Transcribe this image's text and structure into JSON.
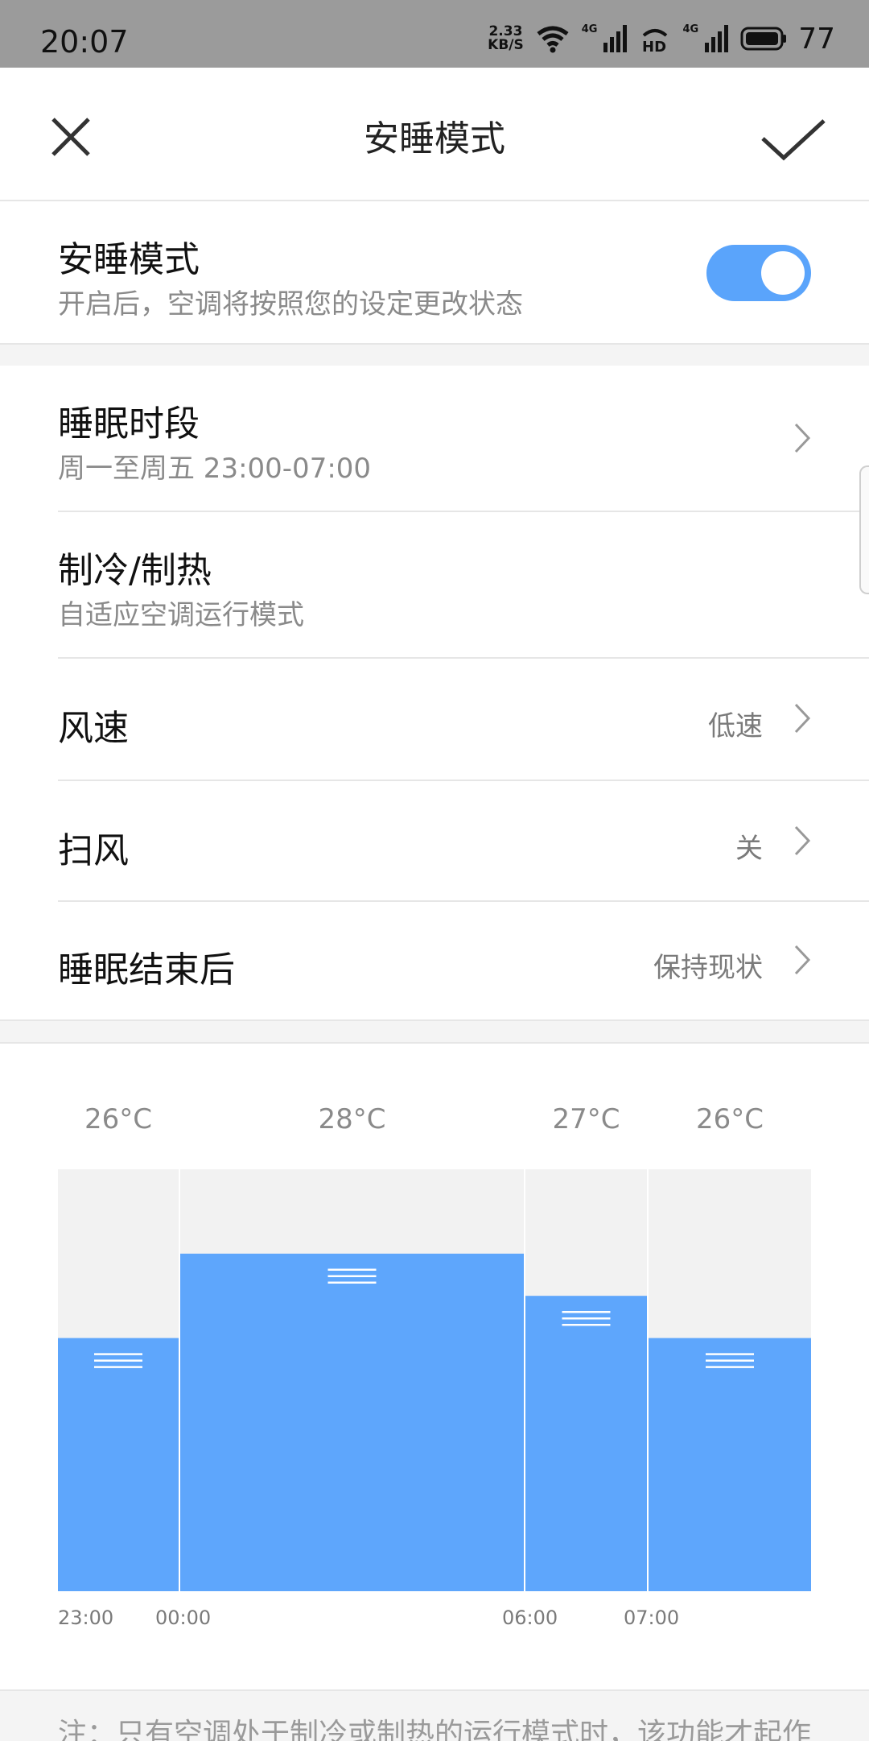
{
  "status_bar": {
    "time": "20:07",
    "net_speed_value": "2.33",
    "net_speed_unit": "KB/S",
    "signal_tag_1": "4G",
    "hd_label": "HD",
    "signal_tag_2": "4G",
    "battery": "77"
  },
  "header": {
    "title": "安睡模式"
  },
  "sleep_mode": {
    "label": "安睡模式",
    "description": "开启后，空调将按照您的设定更改状态",
    "enabled": true
  },
  "settings": [
    {
      "label": "睡眠时段",
      "sub": "周一至周五 23:00-07:00",
      "value": ""
    },
    {
      "label": "制冷/制热",
      "sub": "自适应空调运行模式",
      "value": ""
    },
    {
      "label": "风速",
      "sub": "",
      "value": "低速"
    },
    {
      "label": "扫风",
      "sub": "",
      "value": "关"
    },
    {
      "label": "睡眠结束后",
      "sub": "",
      "value": "保持现状"
    }
  ],
  "chart_data": {
    "type": "bar",
    "categories": [
      "23:00-00:00",
      "00:00-06:00",
      "06:00-07:00",
      "07:00-"
    ],
    "values": [
      26,
      28,
      27,
      26
    ],
    "value_labels": [
      "26°C",
      "28°C",
      "27°C",
      "26°C"
    ],
    "x_tick_labels": [
      "23:00",
      "00:00",
      "06:00",
      "07:00"
    ],
    "ylim": [
      20,
      30
    ],
    "colors": {
      "bar": "#5ea6fc",
      "track": "#f2f2f2"
    }
  },
  "note": "注：只有空调处于制冷或制热的运行模式时，该功能才起作"
}
